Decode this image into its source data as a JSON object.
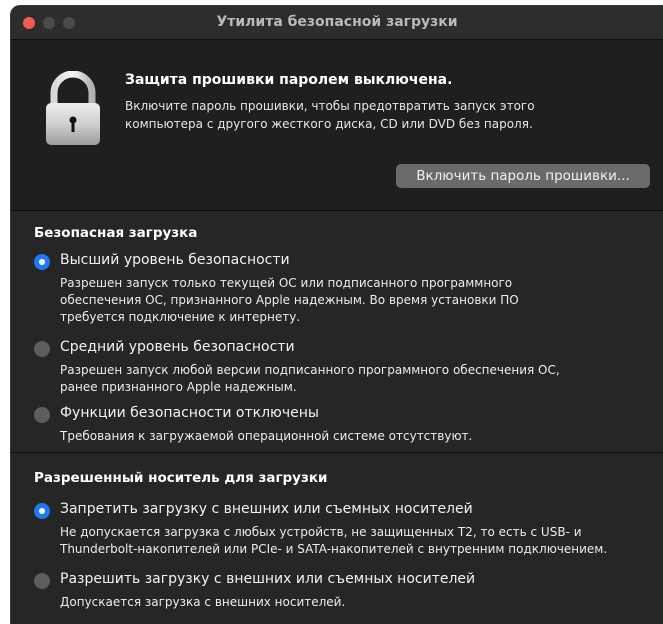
{
  "window": {
    "title": "Утилита безопасной загрузки"
  },
  "firmware": {
    "icon": "lock-icon",
    "title": "Защита прошивки паролем выключена.",
    "desc_line1": "Включите пароль прошивки, чтобы предотвратить запуск этого",
    "desc_line2": "компьютера с другого жесткого диска, CD или DVD без пароля.",
    "button_label": "Включить пароль прошивки..."
  },
  "secure_boot": {
    "title": "Безопасная загрузка",
    "options": [
      {
        "label": "Высший уровень безопасности",
        "selected": true,
        "desc_lines": [
          "Разрешен запуск только текущей ОС или подписанного программного",
          "обеспечения ОС, признанного Apple надежным. Во время установки ПО",
          "требуется подключение к интернету."
        ]
      },
      {
        "label": "Средний уровень безопасности",
        "selected": false,
        "desc_lines": [
          "Разрешен запуск любой версии подписанного программного обеспечения ОС,",
          "ранее признанного Apple надежным."
        ]
      },
      {
        "label": "Функции безопасности отключены",
        "selected": false,
        "desc_lines": [
          "Требования к загружаемой операционной системе отсутствуют."
        ]
      }
    ]
  },
  "boot_media": {
    "title": "Разрешенный носитель для загрузки",
    "options": [
      {
        "label": "Запретить загрузку с внешних или съемных носителей",
        "selected": true,
        "desc_lines": [
          "Не допускается загрузка с любых устройств, не защищенных T2, то есть с USB- и",
          "Thunderbolt-накопителей или PCIe- и SATA-накопителей с внутренним подключением."
        ]
      },
      {
        "label": "Разрешить загрузку с внешних или съемных носителей",
        "selected": false,
        "desc_lines": [
          "Допускается загрузка с внешних носителей."
        ]
      }
    ]
  },
  "colors": {
    "accent": "#1e7af0",
    "close": "#ee5d54"
  }
}
